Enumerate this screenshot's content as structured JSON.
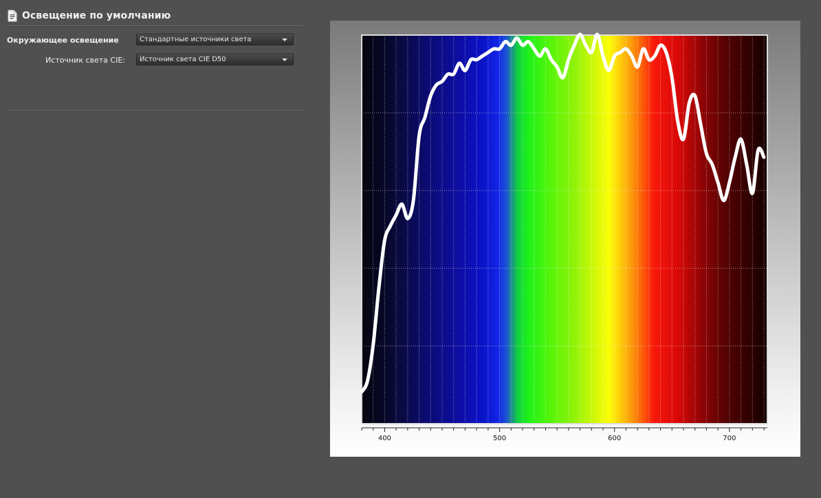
{
  "panel": {
    "title": "Освещение по умолчанию",
    "ambient_label": "Окружающее освещение",
    "ambient_value": "Стандартные источники света",
    "cie_label": "Источник света CIE:",
    "cie_value": "Источник света CIE D50"
  },
  "chart_data": {
    "type": "line",
    "title": "",
    "xlabel": "",
    "ylabel": "",
    "xlim": [
      380,
      733
    ],
    "ylim": [
      0,
      100
    ],
    "x_ticks": [
      400,
      500,
      600,
      700
    ],
    "x_tick_labels": [
      "400",
      "500",
      "600",
      "700"
    ],
    "grid": true,
    "background": "visible spectrum gradient",
    "line_color": "#ffffff",
    "series": [
      {
        "x": [
          380,
          385,
          390,
          395,
          400,
          405,
          410,
          415,
          420,
          425,
          430,
          435,
          440,
          445,
          450,
          455,
          460,
          465,
          470,
          475,
          480,
          485,
          490,
          495,
          500,
          505,
          510,
          515,
          520,
          525,
          530,
          535,
          540,
          545,
          550,
          555,
          560,
          565,
          570,
          575,
          580,
          585,
          590,
          595,
          600,
          605,
          610,
          615,
          620,
          625,
          630,
          635,
          640,
          645,
          650,
          655,
          660,
          665,
          670,
          675,
          680,
          685,
          690,
          695,
          700,
          705,
          710,
          715,
          720,
          725,
          730
        ],
        "y": [
          5,
          8,
          18,
          34,
          47,
          51,
          54,
          57,
          53,
          58,
          76,
          81,
          87,
          90,
          91,
          93,
          93,
          96,
          94,
          97,
          97,
          98,
          99,
          100,
          100,
          102,
          101,
          103,
          101,
          102,
          100,
          98,
          100,
          97,
          95,
          92,
          97,
          101,
          104,
          101,
          99,
          104,
          98,
          94,
          98,
          99,
          100,
          98,
          95,
          100,
          97,
          98,
          101,
          99,
          92,
          80,
          75,
          85,
          87,
          79,
          71,
          68,
          63,
          58,
          63,
          70,
          75,
          68,
          60,
          72,
          70
        ]
      }
    ]
  }
}
